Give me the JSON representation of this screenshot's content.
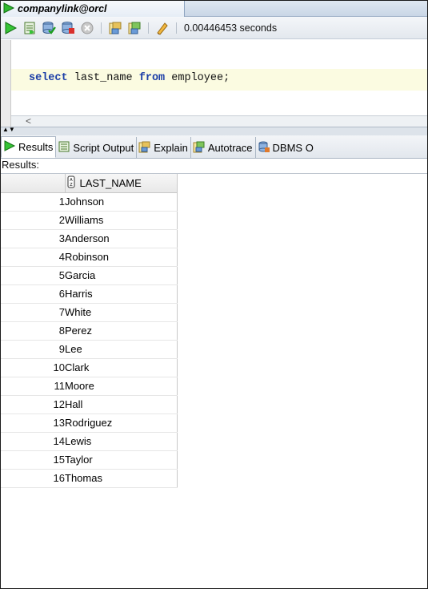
{
  "window": {
    "title": "companylink@orcl"
  },
  "toolbar": {
    "execution_time": "0.00446453 seconds"
  },
  "editor": {
    "kw_select": "select",
    "col_text": "last_name",
    "kw_from": "from",
    "table_text": "employee;"
  },
  "tabs": [
    {
      "label": "Results",
      "active": true
    },
    {
      "label": "Script Output",
      "active": false
    },
    {
      "label": "Explain",
      "active": false
    },
    {
      "label": "Autotrace",
      "active": false
    },
    {
      "label": "DBMS O",
      "active": false
    }
  ],
  "results": {
    "label": "Results:",
    "column_header": "LAST_NAME",
    "rows": [
      {
        "num": "1",
        "last_name": "Johnson"
      },
      {
        "num": "2",
        "last_name": "Williams"
      },
      {
        "num": "3",
        "last_name": "Anderson"
      },
      {
        "num": "4",
        "last_name": "Robinson"
      },
      {
        "num": "5",
        "last_name": "Garcia"
      },
      {
        "num": "6",
        "last_name": "Harris"
      },
      {
        "num": "7",
        "last_name": "White"
      },
      {
        "num": "8",
        "last_name": "Perez"
      },
      {
        "num": "9",
        "last_name": "Lee"
      },
      {
        "num": "10",
        "last_name": "Clark"
      },
      {
        "num": "11",
        "last_name": "Moore"
      },
      {
        "num": "12",
        "last_name": "Hall"
      },
      {
        "num": "13",
        "last_name": "Rodriguez"
      },
      {
        "num": "14",
        "last_name": "Lewis"
      },
      {
        "num": "15",
        "last_name": "Taylor"
      },
      {
        "num": "16",
        "last_name": "Thomas"
      }
    ]
  },
  "colors": {
    "run_green": "#2eb82e",
    "keyword": "#1c3ea7"
  },
  "icons": [
    "run-statement-icon",
    "run-script-icon",
    "commit-icon",
    "rollback-icon",
    "cancel-icon",
    "explain-icon",
    "autotrace-icon",
    "clear-icon"
  ]
}
